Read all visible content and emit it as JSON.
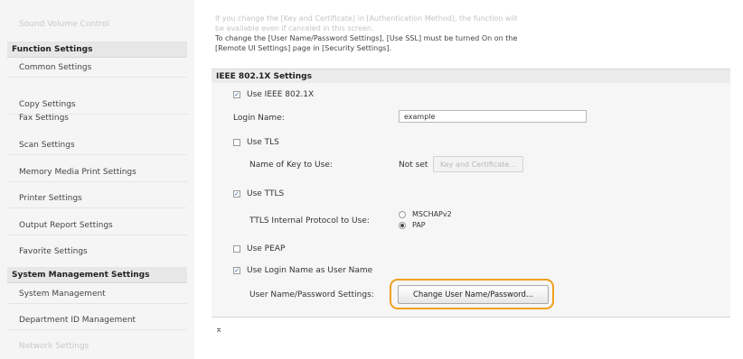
{
  "sidebar": {
    "items": [
      {
        "label": "Sound Volume Control",
        "kind": "faded"
      },
      {
        "label": "Function Settings",
        "kind": "header"
      },
      {
        "label": "Common Settings",
        "kind": "item"
      },
      {
        "label": "Copy Settings",
        "kind": "item"
      },
      {
        "label": "Fax Settings",
        "kind": "item"
      },
      {
        "label": "Scan Settings",
        "kind": "item"
      },
      {
        "label": "Memory Media Print Settings",
        "kind": "item"
      },
      {
        "label": "Printer Settings",
        "kind": "item"
      },
      {
        "label": "Output Report Settings",
        "kind": "item"
      },
      {
        "label": "Favorite Settings",
        "kind": "item"
      },
      {
        "label": "System Management Settings",
        "kind": "header"
      },
      {
        "label": "System Management",
        "kind": "item"
      },
      {
        "label": "Department ID Management",
        "kind": "item"
      },
      {
        "label": "Network Settings",
        "kind": "faded"
      }
    ]
  },
  "notes": {
    "line1": "If you change the [Key and Certificate] in [Authentication Method], the function will",
    "line2": "be available even if canceled in this screen.",
    "line3": "To change the [User Name/Password Settings], [Use SSL] must be turned On on the",
    "line4": "[Remote UI Settings] page in [Security Settings]."
  },
  "section": {
    "title": "IEEE 802.1X Settings",
    "use_ieee_label": "Use IEEE 802.1X",
    "use_ieee_checked": true,
    "login_name_label": "Login Name:",
    "login_name_value": "example",
    "use_tls_label": "Use TLS",
    "use_tls_checked": false,
    "key_name_label": "Name of Key to Use:",
    "key_name_value": "Not set",
    "key_button_label": "Key and Certificate...",
    "use_ttls_label": "Use TTLS",
    "use_ttls_checked": true,
    "ttls_protocol_label": "TTLS Internal Protocol to Use:",
    "ttls_options": [
      "MSCHAPv2",
      "PAP"
    ],
    "ttls_selected": "PAP",
    "use_peap_label": "Use PEAP",
    "use_peap_checked": false,
    "use_login_label": "Use Login Name as User Name",
    "use_login_checked": true,
    "user_pw_label": "User Name/Password Settings:",
    "change_button_label": "Change User Name/Password..."
  },
  "footer": {
    "top_link": "⌅"
  },
  "colors": {
    "highlight": "#f0a020",
    "checkmark": "#3a5a9a"
  }
}
